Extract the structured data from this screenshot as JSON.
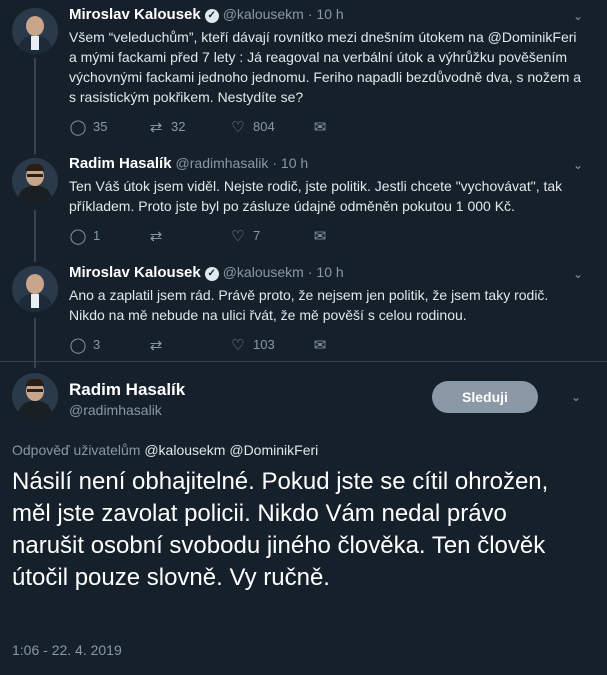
{
  "tweets": [
    {
      "author": "Miroslav Kalousek",
      "handle": "@kalousekm",
      "time": "· 10 h",
      "text": "Všem “veleduchům”, kteří dávají rovnítko mezi dnešním útokem na @DominikFeri a mými fackami před 7 lety : Já reagoval na verbální útok a výhrůžku pověšením výchovnými fackami jednoho jednomu. Feriho napadli bezdůvodně dva, s nožem a s rasistickým pokřikem. Nestydíte se?",
      "replies": "35",
      "retweets": "32",
      "likes": "804"
    },
    {
      "author": "Radim Hasalík",
      "handle": "@radimhasalik",
      "time": "· 10 h",
      "text": "Ten Váš útok jsem viděl. Nejste rodič, jste politik. Jestli chcete \"vychovávat\", tak příkladem. Proto jste byl po zásluze údajně odměněn pokutou 1 000 Kč.",
      "replies": "1",
      "retweets": "",
      "likes": "7"
    },
    {
      "author": "Miroslav Kalousek",
      "handle": "@kalousekm",
      "time": "· 10 h",
      "text": "Ano a zaplatil jsem rád. Právě proto, že nejsem jen politik, že jsem taky rodič. Nikdo na mě nebude na ulici řvát, že mě pověší s celou rodinou.",
      "replies": "3",
      "retweets": "",
      "likes": "103"
    }
  ],
  "main": {
    "author": "Radim Hasalík",
    "handle": "@radimhasalik",
    "follow_label": "Sleduji",
    "reply_prefix": "Odpověď uživatelům",
    "reply_mentions": "@kalousekm @DominikFeri",
    "text": "Násilí není obhajitelné. Pokud jste se cítil ohrožen, měl jste zavolat policii. Nikdo Vám nedal právo narušit osobní svobodu jiného člověka. Ten člověk útočil pouze slovně. Vy ručně.",
    "timestamp": "1:06 - 22. 4. 2019"
  },
  "icons": {
    "reply": "speech-bubble-icon",
    "retweet": "retweet-icon",
    "like": "heart-icon",
    "dm": "envelope-icon",
    "verified": "verified-badge-icon",
    "caret": "chevron-down-icon"
  },
  "colors": {
    "background": "#15202b",
    "text": "#e1e8ed",
    "muted": "#8899a6",
    "divider": "#38444d",
    "follow_button": "#8b98a5"
  }
}
